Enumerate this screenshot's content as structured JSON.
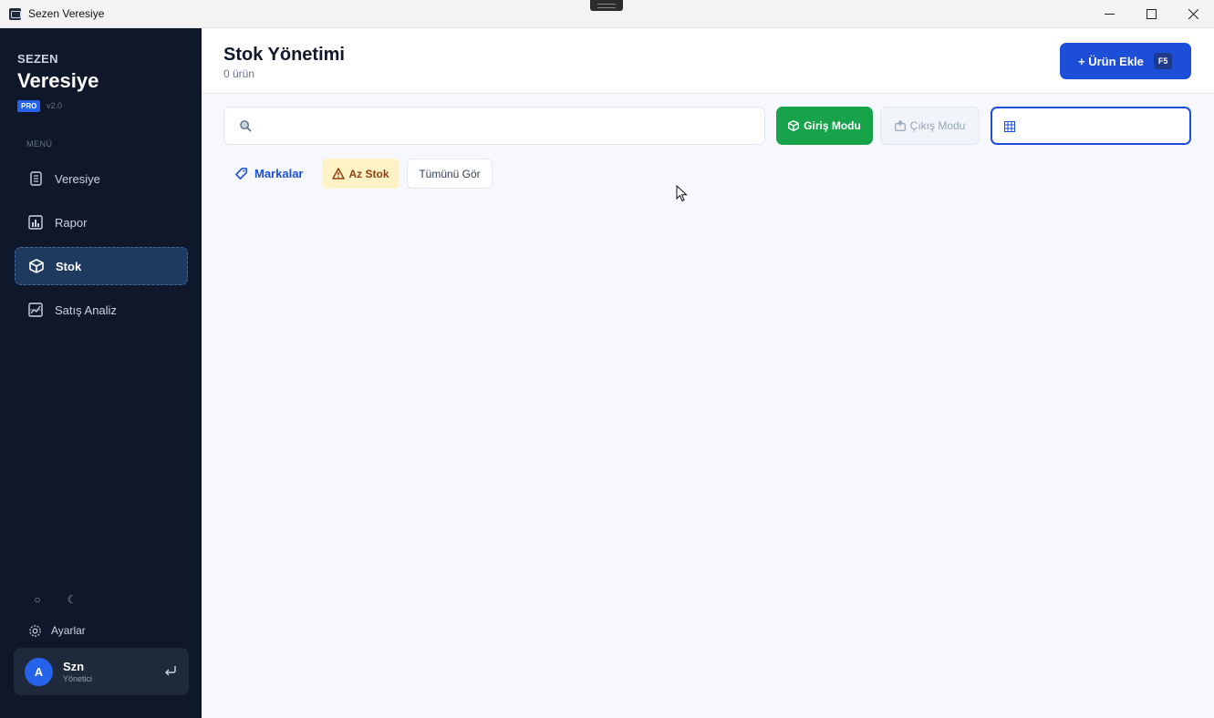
{
  "window": {
    "title": "Sezen Veresiye"
  },
  "sidebar": {
    "brand_top": "SEZEN",
    "brand_main": "Veresiye",
    "badge": "PRO",
    "version": "v2.0",
    "menu_label": "MENÜ",
    "items": [
      {
        "label": "Veresiye",
        "icon": "ledger-icon",
        "active": false
      },
      {
        "label": "Rapor",
        "icon": "bar-chart-icon",
        "active": false
      },
      {
        "label": "Stok",
        "icon": "box-icon",
        "active": true
      },
      {
        "label": "Satış Analiz",
        "icon": "analytics-icon",
        "active": false
      }
    ],
    "theme": {
      "light_symbol": "○",
      "dark_symbol": "☾"
    },
    "settings_label": "Ayarlar",
    "user": {
      "initial": "A",
      "name": "Szn",
      "role": "Yönetici"
    }
  },
  "header": {
    "title": "Stok Yönetimi",
    "subtitle": "0 ürün",
    "add_button": "+ Ürün Ekle",
    "add_shortcut": "F5"
  },
  "toolbar": {
    "search": {
      "value": "",
      "placeholder": ""
    },
    "mode_in": "Giriş Modu",
    "mode_out": "Çıkış Modu",
    "barcode": {
      "value": "",
      "placeholder": ""
    }
  },
  "filters": {
    "brands": "Markalar",
    "low_stock": "Az Stok",
    "show_all": "Tümünü Gör"
  },
  "colors": {
    "sidebar_bg": "#0f172a",
    "primary": "#1d4ed8",
    "success": "#16a34a",
    "warning_bg": "#fef3c7"
  }
}
